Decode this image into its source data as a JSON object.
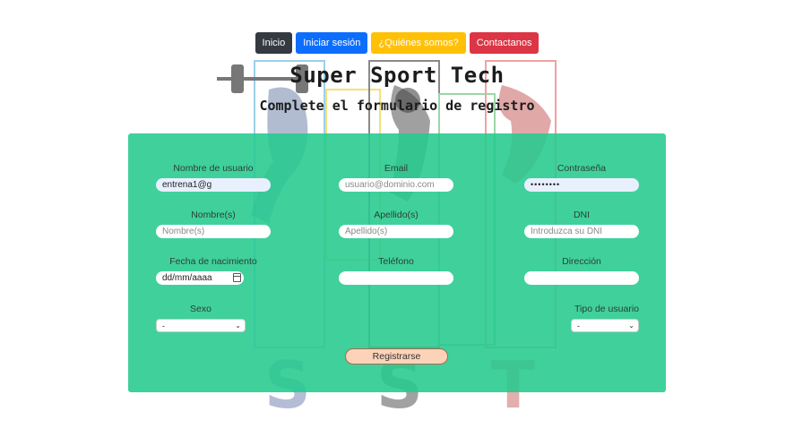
{
  "nav": {
    "home": "Inicio",
    "login": "Iniciar sesión",
    "about": "¿Quiénes somos?",
    "contact": "Contactanos"
  },
  "header": {
    "title": "Super Sport Tech",
    "subtitle": "Complete el formulario de registro"
  },
  "form": {
    "username": {
      "label": "Nombre de usuario",
      "value": "entrena1@g"
    },
    "email": {
      "label": "Email",
      "placeholder": "usuario@dominio.com"
    },
    "password": {
      "label": "Contraseña",
      "value": "••••••••"
    },
    "first_name": {
      "label": "Nombre(s)",
      "placeholder": "Nombre(s)"
    },
    "last_name": {
      "label": "Apellido(s)",
      "placeholder": "Apellido(s)"
    },
    "dni": {
      "label": "DNI",
      "placeholder": "Introduzca su DNI"
    },
    "birth_date": {
      "label": "Fecha de nacimiento",
      "placeholder": "dd/mm/aaaa"
    },
    "phone": {
      "label": "Teléfono",
      "value": ""
    },
    "address": {
      "label": "Dirección",
      "value": ""
    },
    "sex": {
      "label": "Sexo",
      "selected": "-"
    },
    "user_type": {
      "label": "Tipo de usuario",
      "selected": "-"
    },
    "submit_label": "Registrarse"
  },
  "colors": {
    "panel": "#26c98e",
    "submit": "#fcd2b8"
  }
}
